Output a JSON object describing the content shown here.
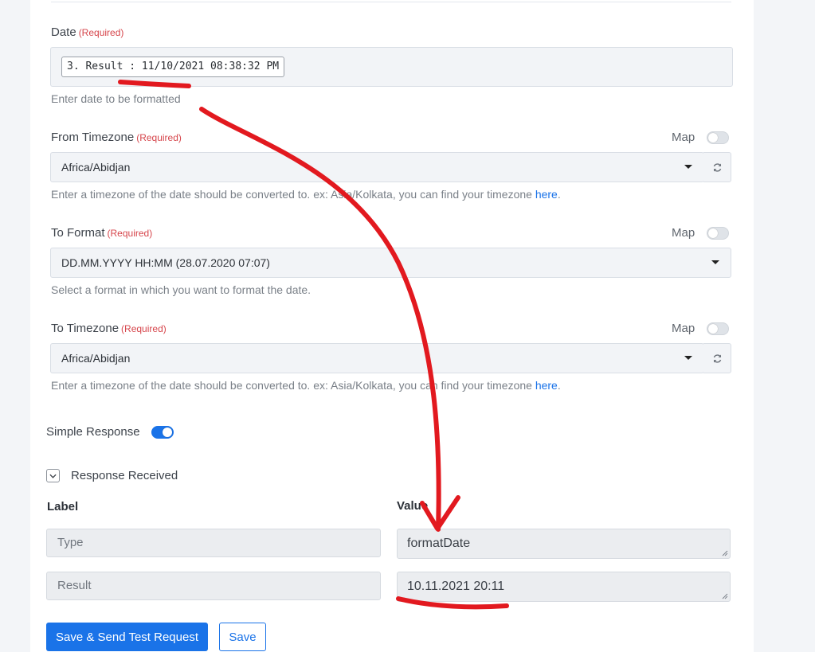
{
  "date_field": {
    "label": "Date",
    "required": "(Required)",
    "value": "3. Result : 11/10/2021 08:38:32 PM",
    "hint": "Enter date to be formatted"
  },
  "from_timezone": {
    "label": "From Timezone",
    "required": "(Required)",
    "map_label": "Map",
    "selected": "Africa/Abidjan",
    "hint": "Enter a timezone of the date should be converted to. ex: Asia/Kolkata, you can find your timezone",
    "hint_link": "here",
    "hint_end": "."
  },
  "to_format": {
    "label": "To Format",
    "required": "(Required)",
    "map_label": "Map",
    "selected": "DD.MM.YYYY HH:MM (28.07.2020 07:07)",
    "hint": "Select a format in which you want to format the date."
  },
  "to_timezone": {
    "label": "To Timezone",
    "required": "(Required)",
    "map_label": "Map",
    "selected": "Africa/Abidjan",
    "hint": "Enter a timezone of the date should be converted to. ex: Asia/Kolkata, you can find your timezone",
    "hint_link": "here",
    "hint_end": "."
  },
  "simple_response": {
    "label": "Simple Response",
    "enabled": true
  },
  "response": {
    "title": "Response Received",
    "label_header": "Label",
    "value_header": "Value",
    "rows": [
      {
        "label": "Type",
        "value": "formatDate"
      },
      {
        "label": "Result",
        "value": "10.11.2021 20:11"
      }
    ]
  },
  "buttons": {
    "primary": "Save & Send Test Request",
    "secondary": "Save"
  },
  "colors": {
    "accent": "#1a73e8",
    "required": "#d6454b",
    "annotation": "#e2191f"
  }
}
